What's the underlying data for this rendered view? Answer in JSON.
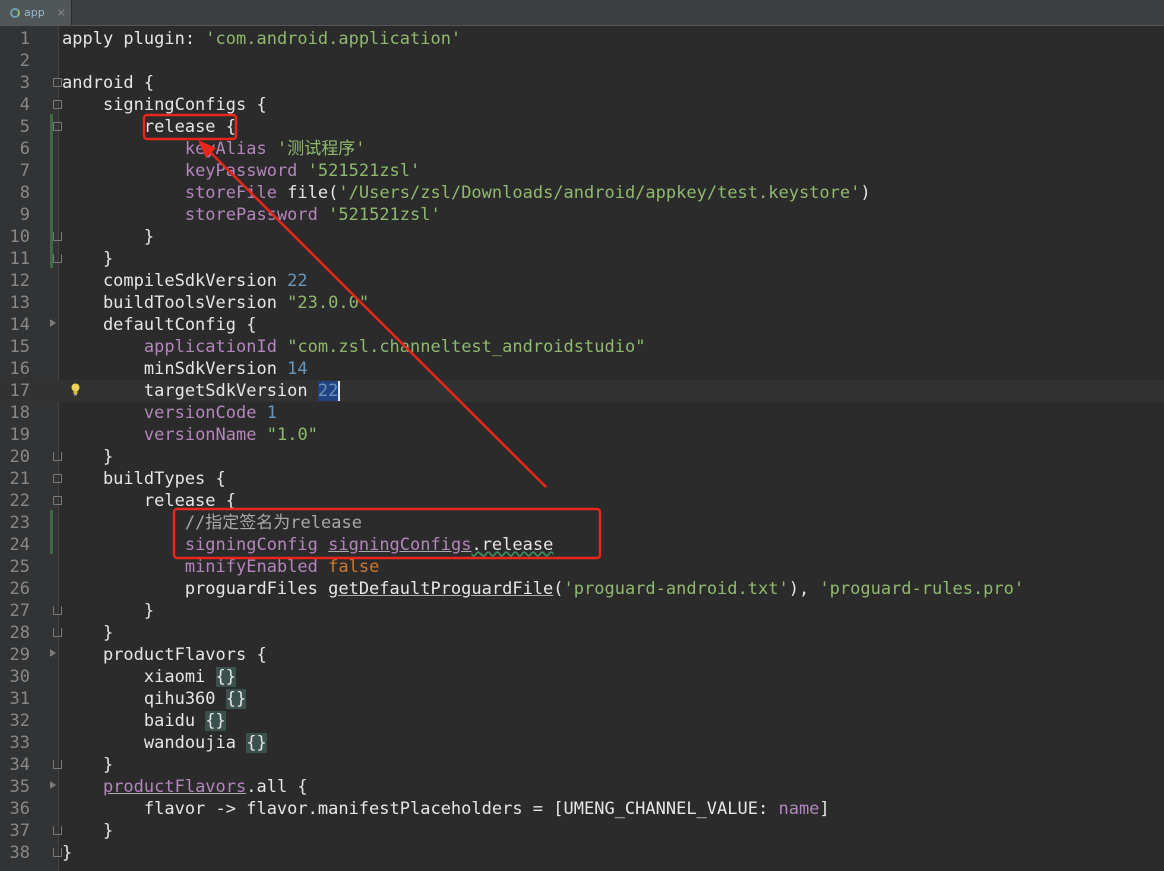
{
  "tab": {
    "label": "app",
    "close": "×"
  },
  "lines": [
    {
      "n": "1"
    },
    {
      "n": "2"
    },
    {
      "n": "3"
    },
    {
      "n": "4"
    },
    {
      "n": "5"
    },
    {
      "n": "6"
    },
    {
      "n": "7"
    },
    {
      "n": "8"
    },
    {
      "n": "9"
    },
    {
      "n": "10"
    },
    {
      "n": "11"
    },
    {
      "n": "12"
    },
    {
      "n": "13"
    },
    {
      "n": "14"
    },
    {
      "n": "15"
    },
    {
      "n": "16"
    },
    {
      "n": "17"
    },
    {
      "n": "18"
    },
    {
      "n": "19"
    },
    {
      "n": "20"
    },
    {
      "n": "21"
    },
    {
      "n": "22"
    },
    {
      "n": "23"
    },
    {
      "n": "24"
    },
    {
      "n": "25"
    },
    {
      "n": "26"
    },
    {
      "n": "27"
    },
    {
      "n": "28"
    },
    {
      "n": "29"
    },
    {
      "n": "30"
    },
    {
      "n": "31"
    },
    {
      "n": "32"
    },
    {
      "n": "33"
    },
    {
      "n": "34"
    },
    {
      "n": "35"
    },
    {
      "n": "36"
    },
    {
      "n": "37"
    },
    {
      "n": "38"
    }
  ],
  "code": {
    "l1": [
      "apply plugin: ",
      "'com.android.application'"
    ],
    "l3": "android {",
    "l4": "    signingConfigs {",
    "l5": [
      "        ",
      "release",
      " {"
    ],
    "l6": [
      "            ",
      "keyAlias",
      " ",
      "'测试程序'"
    ],
    "l7": [
      "            ",
      "keyPassword",
      " ",
      "'521521zsl'"
    ],
    "l8": [
      "            ",
      "storeFile",
      " file(",
      "'/Users/zsl/Downloads/android/appkey/test.keystore'",
      ")"
    ],
    "l9": [
      "            ",
      "storePassword",
      " ",
      "'521521zsl'"
    ],
    "l10": "        }",
    "l11": "    }",
    "l12": [
      "    compileSdkVersion ",
      "22"
    ],
    "l13": [
      "    buildToolsVersion ",
      "\"23.0.0\""
    ],
    "l14": "    defaultConfig {",
    "l15": [
      "        ",
      "applicationId",
      " ",
      "\"com.zsl.channeltest_androidstudio\""
    ],
    "l16": [
      "        minSdkVersion ",
      "14"
    ],
    "l17": [
      "        targetSdkVersion ",
      "22"
    ],
    "l18": [
      "        ",
      "versionCode",
      " ",
      "1"
    ],
    "l19": [
      "        ",
      "versionName",
      " ",
      "\"1.0\""
    ],
    "l20": "    }",
    "l21": "    buildTypes {",
    "l22": "        release {",
    "l23": [
      "            ",
      "//指定签名为release"
    ],
    "l24": [
      "            ",
      "signingConfig",
      " ",
      "signingConfigs",
      ".",
      "release"
    ],
    "l25": [
      "            ",
      "minifyEnabled",
      " ",
      "false"
    ],
    "l26": [
      "            proguardFiles ",
      "getDefaultProguardFile",
      "(",
      "'proguard-android.txt'",
      "), ",
      "'proguard-rules.pro'"
    ],
    "l27": "        }",
    "l28": "    }",
    "l29": "    productFlavors {",
    "l30": [
      "        xiaomi ",
      "{}"
    ],
    "l31": [
      "        qihu360 ",
      "{}"
    ],
    "l32": [
      "        baidu ",
      "{}"
    ],
    "l33": [
      "        wandoujia ",
      "{}"
    ],
    "l34": "    }",
    "l35": [
      "    ",
      "productFlavors",
      ".all {"
    ],
    "l36": [
      "        flavor -> flavor.manifestPlaceholders = [",
      "UMENG_CHANNEL_VALUE",
      ": ",
      "name",
      "]"
    ],
    "l37": "    }",
    "l38": "}"
  },
  "colors": {
    "background": "#2b2b2b",
    "string": "#8fba6e",
    "number": "#6897bb",
    "property": "#b486bd",
    "keyword": "#cc7832",
    "annotation": "#e8261c"
  }
}
